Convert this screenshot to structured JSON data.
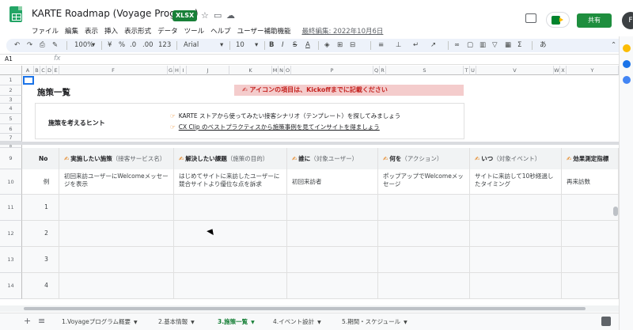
{
  "title": {
    "doc_name": "KARTE Roadmap (Voyage Program)",
    "format_badge": "XLSX",
    "last_edit": "最終編集: 2022年10月6日",
    "share_label": "共有",
    "avatar_letter": "F"
  },
  "menu": [
    "ファイル",
    "編集",
    "表示",
    "挿入",
    "表示形式",
    "データ",
    "ツール",
    "ヘルプ",
    "ユーザー補助機能"
  ],
  "toolbar": {
    "zoom": "100%",
    "currency": "¥",
    "percent": "%",
    "decimal_dec": ".0",
    "decimal_inc": ".00",
    "more_formats": "123",
    "font": "Arial",
    "font_size": "10",
    "bold": "B",
    "italic": "I",
    "strike": "S",
    "text_color": "A",
    "input_tool": "あ"
  },
  "formula_bar": {
    "name_box": "A1",
    "fx": "fx"
  },
  "columns": [
    "A",
    "B",
    "C",
    "D",
    "E",
    "F",
    "G",
    "H",
    "I",
    "J",
    "K",
    "L",
    "M",
    "N",
    "O",
    "P",
    "Q",
    "R",
    "S",
    "T",
    "U",
    "V",
    "W",
    "X",
    "Y"
  ],
  "rows": [
    "1",
    "2",
    "3",
    "4",
    "5",
    "6",
    "7",
    "8",
    "9",
    "10",
    "11",
    "12",
    "13",
    "14"
  ],
  "sheet": {
    "page_title": "施策一覧",
    "notice": "アイコンの項目は、Kickoffまでに記載ください",
    "hint_label": "施策を考えるヒント",
    "hint_1": "KARTE ストアから使ってみたい接客シナリオ（テンプレート）を探してみましょう",
    "hint_2": "CX Clip のベストプラクティスから施策事例を見てインサイトを得ましょう"
  },
  "table": {
    "headers": [
      {
        "main": "No",
        "sub": ""
      },
      {
        "main": "実施したい施策",
        "sub": "（接客サービス名）"
      },
      {
        "main": "解決したい課題",
        "sub": "（施策の目的）"
      },
      {
        "main": "誰に",
        "sub": "（対象ユーザー）"
      },
      {
        "main": "何を",
        "sub": "（アクション）"
      },
      {
        "main": "いつ",
        "sub": "（対象イベント）"
      },
      {
        "main": "効果測定指標",
        "sub": ""
      }
    ],
    "example": {
      "no": "例",
      "measure": "初回来訪ユーザーにWelcomeメッセージを表示",
      "issue": "はじめてサイトに来訪したユーザーに競合サイトより優位な点を訴求",
      "who": "初回来訪者",
      "what": "ポップアップでWelcomeメッセージ",
      "when": "サイトに来訪して10秒経過したタイミング",
      "kpi": "再来訪数"
    },
    "row_numbers": [
      "1",
      "2",
      "3",
      "4"
    ]
  },
  "tabs": [
    {
      "label": "1.Voyageプログラム概要"
    },
    {
      "label": "2.基本情報"
    },
    {
      "label": "3.施策一覧"
    },
    {
      "label": "4.イベント設計"
    },
    {
      "label": "5.期間・スケジュール"
    }
  ],
  "colors": {
    "brand_green": "#188038",
    "notice_bg": "#f4cccc",
    "notice_text": "#c5221f",
    "selection": "#1a73e8"
  }
}
